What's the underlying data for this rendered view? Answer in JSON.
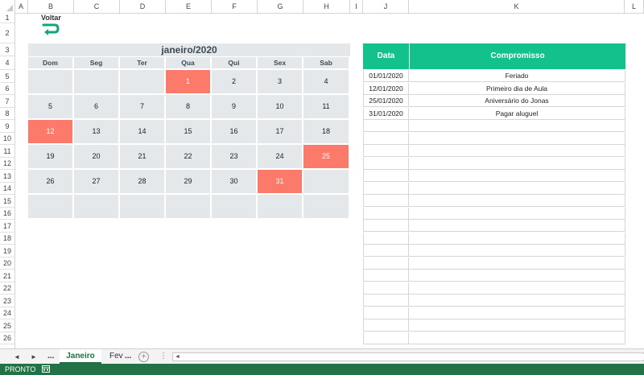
{
  "columns": [
    "A",
    "B",
    "C",
    "D",
    "E",
    "F",
    "G",
    "H",
    "I",
    "J",
    "K",
    "L"
  ],
  "rows": [
    "1",
    "2",
    "3",
    "4",
    "5",
    "6",
    "7",
    "8",
    "9",
    "10",
    "11",
    "12",
    "13",
    "14",
    "15",
    "16",
    "17",
    "18",
    "19",
    "20",
    "21",
    "22",
    "23",
    "24",
    "25",
    "26"
  ],
  "voltar": {
    "label": "Voltar",
    "icon": "return-arrow-icon"
  },
  "calendar": {
    "title": "janeiro/2020",
    "weekdays": [
      "Dom",
      "Seg",
      "Ter",
      "Qua",
      "Qui",
      "Sex",
      "Sab"
    ],
    "highlight_color": "#fb7a69",
    "weeks": [
      [
        "",
        "",
        "",
        "1",
        "2",
        "3",
        "4"
      ],
      [
        "5",
        "6",
        "7",
        "8",
        "9",
        "10",
        "11"
      ],
      [
        "12",
        "13",
        "14",
        "15",
        "16",
        "17",
        "18"
      ],
      [
        "19",
        "20",
        "21",
        "22",
        "23",
        "24",
        "25"
      ],
      [
        "26",
        "27",
        "28",
        "29",
        "30",
        "31",
        ""
      ],
      [
        "",
        "",
        "",
        "",
        "",
        "",
        ""
      ]
    ],
    "highlighted_days": [
      "1",
      "12",
      "25",
      "31"
    ]
  },
  "appointments": {
    "headers": {
      "date": "Data",
      "event": "Compromisso"
    },
    "header_color": "#13c18c",
    "rows": [
      {
        "date": "01/01/2020",
        "event": "Feriado"
      },
      {
        "date": "12/01/2020",
        "event": "Primeiro dia de Aula"
      },
      {
        "date": "25/01/2020",
        "event": "Aniversário do Jonas"
      },
      {
        "date": "31/01/2020",
        "event": "Pagar aluguel"
      },
      {
        "date": "",
        "event": ""
      },
      {
        "date": "",
        "event": ""
      },
      {
        "date": "",
        "event": ""
      },
      {
        "date": "",
        "event": ""
      },
      {
        "date": "",
        "event": ""
      },
      {
        "date": "",
        "event": ""
      },
      {
        "date": "",
        "event": ""
      },
      {
        "date": "",
        "event": ""
      },
      {
        "date": "",
        "event": ""
      },
      {
        "date": "",
        "event": ""
      },
      {
        "date": "",
        "event": ""
      },
      {
        "date": "",
        "event": ""
      },
      {
        "date": "",
        "event": ""
      },
      {
        "date": "",
        "event": ""
      },
      {
        "date": "",
        "event": ""
      },
      {
        "date": "",
        "event": ""
      },
      {
        "date": "",
        "event": ""
      },
      {
        "date": "",
        "event": ""
      }
    ]
  },
  "tabs": {
    "prev": "◄",
    "next": "►",
    "more_left": "...",
    "active": "Janeiro",
    "next_sheet": "Fev",
    "more_right": "...",
    "add": "+",
    "options": "⋮",
    "scroll_arrow": "◄"
  },
  "status": {
    "text": "PRONTO",
    "bar_color": "#217346",
    "macro_icon": "macro-record-icon"
  }
}
